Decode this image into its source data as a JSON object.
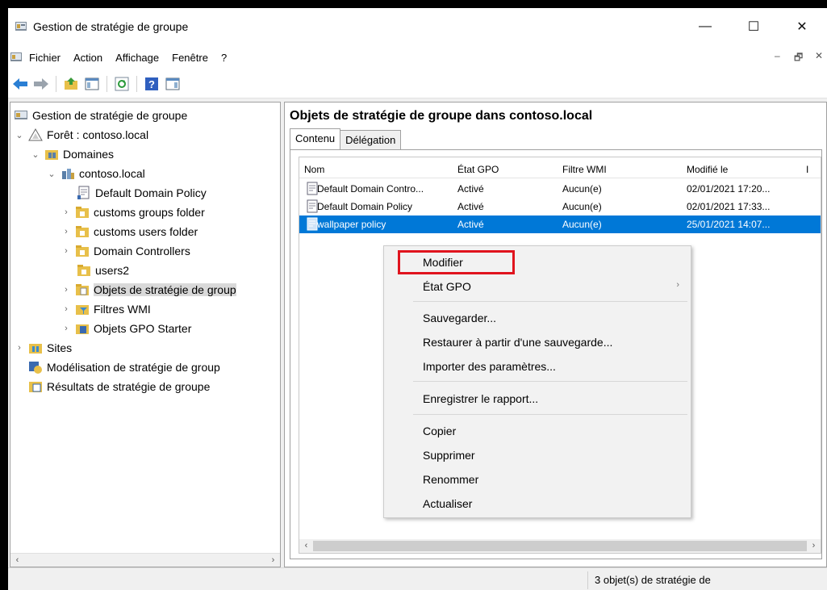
{
  "window": {
    "title": "Gestion de stratégie de groupe",
    "minimize": "—",
    "maximize": "☐",
    "close": "✕"
  },
  "menubar": {
    "items": [
      "Fichier",
      "Action",
      "Affichage",
      "Fenêtre",
      "?"
    ],
    "mdi_min": "–",
    "mdi_restore": "🗗",
    "mdi_close": "✕"
  },
  "tree": {
    "nodes": [
      {
        "label": "Gestion de stratégie de groupe",
        "expander": "",
        "icon": "gpmc-console-icon"
      },
      {
        "label": "Forêt : contoso.local",
        "expander": "⌄",
        "icon": "forest-icon"
      },
      {
        "label": "Domaines",
        "expander": "⌄",
        "icon": "domains-icon"
      },
      {
        "label": "contoso.local",
        "expander": "⌄",
        "icon": "domain-icon"
      },
      {
        "label": "Default Domain Policy",
        "expander": "",
        "icon": "gpo-link-icon"
      },
      {
        "label": "customs groups folder",
        "expander": "›",
        "icon": "ou-folder-icon"
      },
      {
        "label": "customs users folder",
        "expander": "›",
        "icon": "ou-folder-icon"
      },
      {
        "label": "Domain Controllers",
        "expander": "›",
        "icon": "ou-folder-icon"
      },
      {
        "label": "users2",
        "expander": "",
        "icon": "ou-folder-icon"
      },
      {
        "label": "Objets de stratégie de group",
        "expander": "›",
        "icon": "gpo-folder-icon"
      },
      {
        "label": "Filtres WMI",
        "expander": "›",
        "icon": "wmi-filter-icon"
      },
      {
        "label": "Objets GPO Starter",
        "expander": "›",
        "icon": "starter-gpo-icon"
      },
      {
        "label": "Sites",
        "expander": "›",
        "icon": "sites-icon"
      },
      {
        "label": "Modélisation de stratégie de group",
        "expander": "",
        "icon": "modeling-icon"
      },
      {
        "label": "Résultats de stratégie de groupe",
        "expander": "",
        "icon": "results-icon"
      }
    ]
  },
  "right": {
    "title": "Objets de stratégie de groupe dans contoso.local",
    "tabs": [
      "Contenu",
      "Délégation"
    ],
    "columns": [
      "Nom",
      "État GPO",
      "Filtre WMI",
      "Modifié le",
      "I"
    ],
    "rows": [
      {
        "name": "Default Domain Contro...",
        "state": "Activé",
        "wmi": "Aucun(e)",
        "modified": "02/01/2021 17:20..."
      },
      {
        "name": "Default Domain Policy",
        "state": "Activé",
        "wmi": "Aucun(e)",
        "modified": "02/01/2021 17:33..."
      },
      {
        "name": "wallpaper policy",
        "state": "Activé",
        "wmi": "Aucun(e)",
        "modified": "25/01/2021 14:07..."
      }
    ]
  },
  "context_menu": {
    "modifier": "Modifier",
    "etat_gpo": "État GPO",
    "sauvegarder": "Sauvegarder...",
    "restaurer": "Restaurer à partir d'une sauvegarde...",
    "importer": "Importer des paramètres...",
    "enregistrer": "Enregistrer le rapport...",
    "copier": "Copier",
    "supprimer": "Supprimer",
    "renommer": "Renommer",
    "actualiser": "Actualiser",
    "submenu_arrow": "›"
  },
  "status": {
    "count": "3 objet(s) de stratégie de"
  },
  "colors": {
    "selection": "#0078d7",
    "highlight_box": "#e0141e"
  }
}
